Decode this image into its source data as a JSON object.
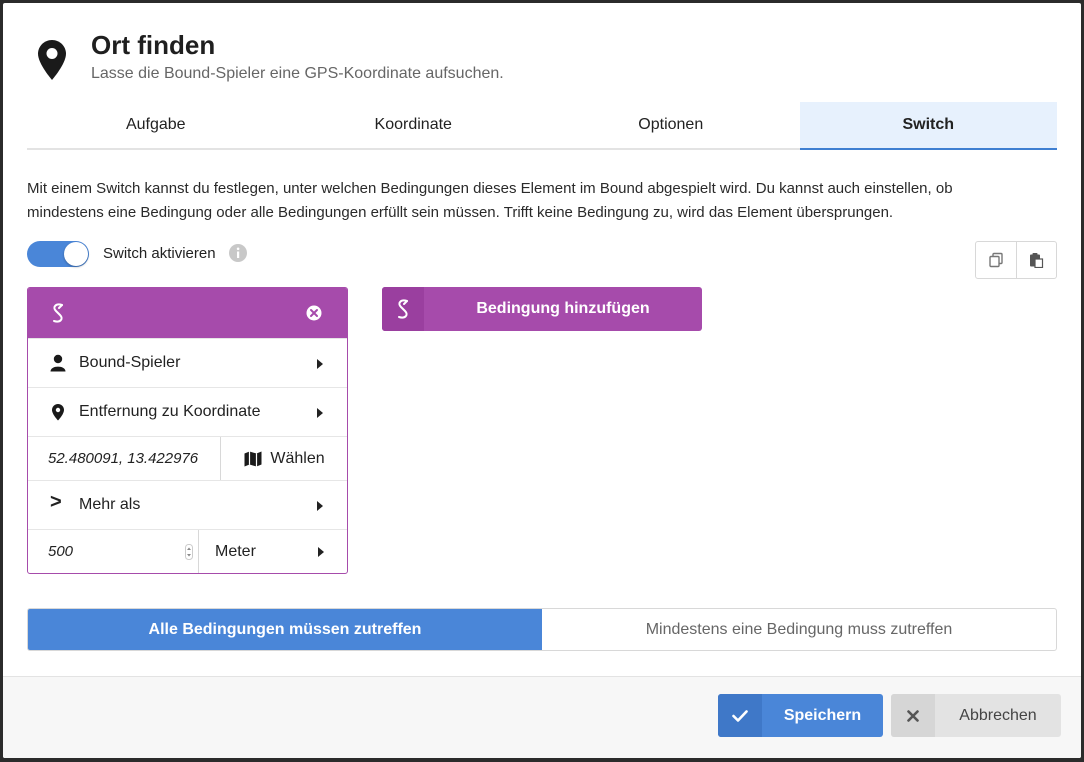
{
  "header": {
    "title": "Ort finden",
    "subtitle": "Lasse die Bound-Spieler eine GPS-Koordinate aufsuchen."
  },
  "tabs": [
    {
      "label": "Aufgabe",
      "active": false
    },
    {
      "label": "Koordinate",
      "active": false
    },
    {
      "label": "Optionen",
      "active": false
    },
    {
      "label": "Switch",
      "active": true
    }
  ],
  "description_line1": "Mit einem Switch kannst du festlegen, unter welchen Bedingungen dieses Element im Bound abgespielt wird. Du kannst auch einstellen, ob",
  "description_line2": "mindestens eine Bedingung oder alle Bedingungen erfüllt sein müssen. Trifft keine Bedingung zu, wird das Element übersprungen.",
  "switch": {
    "label": "Switch aktivieren",
    "enabled": true
  },
  "condition": {
    "subject": "Bound-Spieler",
    "metric": "Entfernung zu Koordinate",
    "coordinate": "52.480091, 13.422976",
    "choose_label": "Wählen",
    "comparator_symbol": ">",
    "comparator": "Mehr als",
    "value": "500",
    "unit": "Meter"
  },
  "add_condition_label": "Bedingung hinzufügen",
  "mode": {
    "all_label": "Alle Bedingungen müssen zutreffen",
    "any_label": "Mindestens eine Bedingung muss zutreffen",
    "selected": "all"
  },
  "footer": {
    "save_label": "Speichern",
    "cancel_label": "Abbrechen"
  },
  "colors": {
    "primary": "#4a86d8",
    "condition": "#a64bab"
  }
}
